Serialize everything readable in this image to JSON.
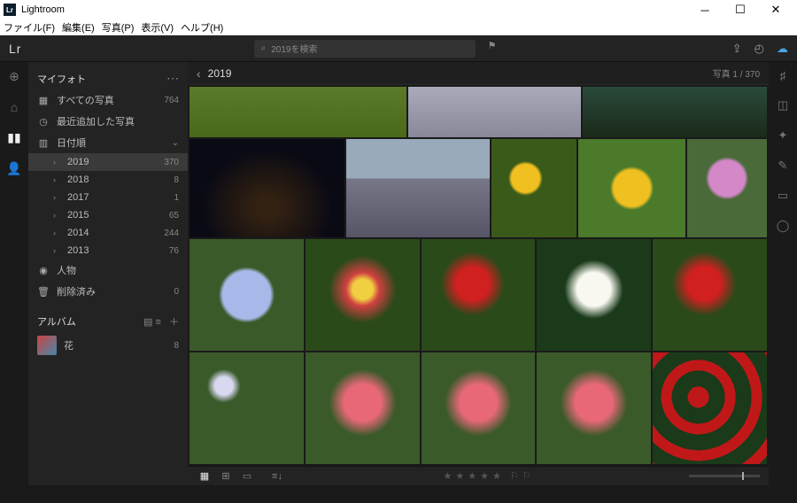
{
  "window": {
    "title": "Lightroom"
  },
  "menu": {
    "file": "ファイル(F)",
    "edit": "編集(E)",
    "photo": "写真(P)",
    "view": "表示(V)",
    "help": "ヘルプ(H)"
  },
  "topbar": {
    "logo": "Lr",
    "search_placeholder": "2019を検索"
  },
  "sidebar": {
    "myphotos_title": "マイフォト",
    "all_photos": {
      "label": "すべての写真",
      "count": "764"
    },
    "recent": {
      "label": "最近追加した写真"
    },
    "by_date": {
      "label": "日付順"
    },
    "years": [
      {
        "label": "2019",
        "count": "370",
        "selected": true
      },
      {
        "label": "2018",
        "count": "8"
      },
      {
        "label": "2017",
        "count": "1"
      },
      {
        "label": "2015",
        "count": "65"
      },
      {
        "label": "2014",
        "count": "244"
      },
      {
        "label": "2013",
        "count": "76"
      }
    ],
    "people": {
      "label": "人物"
    },
    "deleted": {
      "label": "削除済み",
      "count": "0"
    },
    "albums_title": "アルバム",
    "album_flowers": {
      "label": "花",
      "count": "8"
    }
  },
  "main": {
    "title": "2019",
    "count_label": "写真 1 / 370"
  }
}
